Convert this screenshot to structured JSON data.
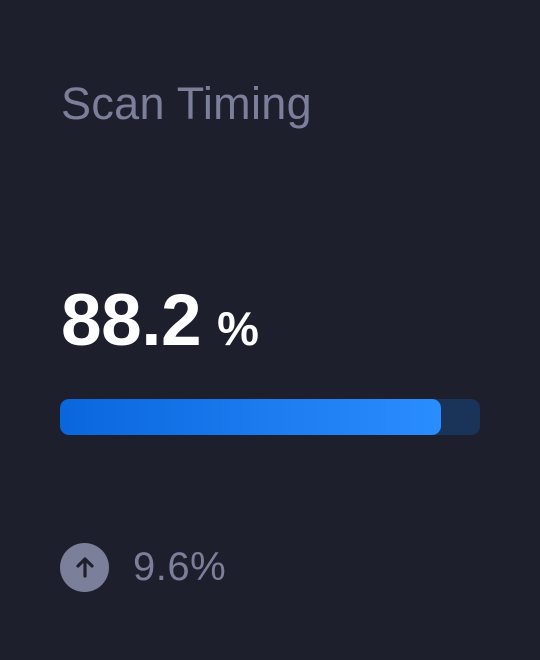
{
  "card": {
    "title": "Scan Timing",
    "metric": {
      "value": "88.2",
      "unit": "%"
    },
    "progress": {
      "fraction": 0.908,
      "colors": {
        "track": "#1a3358",
        "fill_start": "#0a66dd",
        "fill_end": "#2a8dff"
      }
    },
    "trend": {
      "icon": "arrow-up-icon",
      "value": "9.6%"
    },
    "colors": {
      "background": "#1e1f2d",
      "muted_text": "#7b7f99",
      "primary_text": "#ffffff"
    }
  }
}
